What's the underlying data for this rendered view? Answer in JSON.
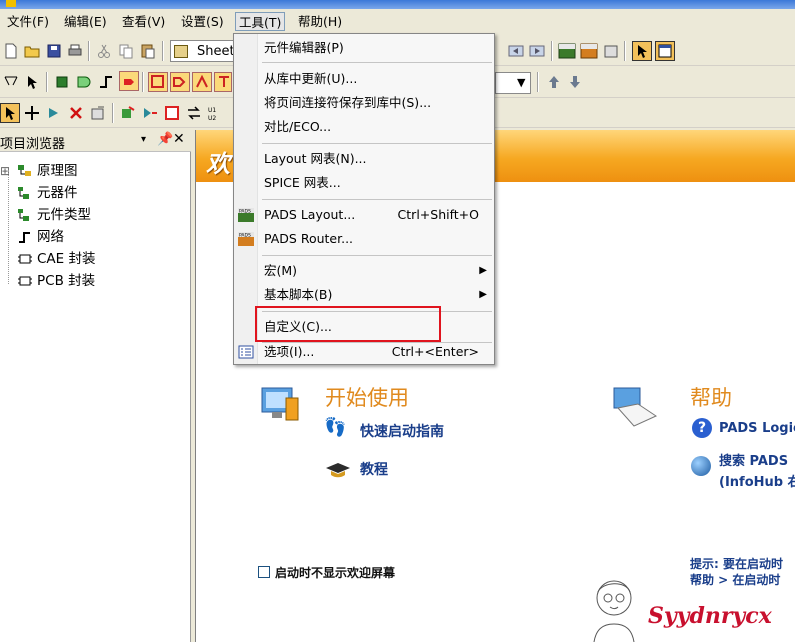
{
  "menubar": {
    "items": [
      {
        "label": "文件(F)"
      },
      {
        "label": "编辑(E)"
      },
      {
        "label": "查看(V)"
      },
      {
        "label": "设置(S)"
      },
      {
        "label": "工具(T)",
        "active": true
      },
      {
        "label": "帮助(H)"
      }
    ]
  },
  "toolbar": {
    "sheet_label": "Sheet"
  },
  "browser": {
    "title": "项目浏览器",
    "pin": "▾",
    "close": "✕",
    "items": [
      {
        "label": "原理图",
        "expander": "⊞"
      },
      {
        "label": "元器件"
      },
      {
        "label": "元件类型"
      },
      {
        "label": "网络"
      },
      {
        "label": "CAE 封装"
      },
      {
        "label": "PCB 封装"
      }
    ]
  },
  "tools_menu": {
    "items": [
      {
        "label": "元件编辑器(P)"
      },
      {
        "label": "从库中更新(U)..."
      },
      {
        "label": "将页间连接符保存到库中(S)..."
      },
      {
        "label": "对比/ECO..."
      },
      {
        "label": "Layout 网表(N)..."
      },
      {
        "label": "SPICE 网表..."
      },
      {
        "label": "PADS Layout...",
        "shortcut": "Ctrl+Shift+O",
        "icon": "pads-layout-icon"
      },
      {
        "label": "PADS Router...",
        "icon": "pads-router-icon"
      },
      {
        "label": "宏(M)",
        "submenu": "▶"
      },
      {
        "label": "基本脚本(B)",
        "submenu": "▶"
      },
      {
        "label": "自定义(C)..."
      },
      {
        "label": "选项(I)...",
        "shortcut": "Ctrl+<Enter>",
        "icon": "options-list-icon"
      }
    ]
  },
  "welcome": {
    "banner": "欢",
    "start": {
      "title": "开始使用",
      "quickstart": "快速启动指南",
      "tutorial": "教程"
    },
    "help": {
      "title": "帮助",
      "pads_logic": "PADS Logic",
      "search_line1": "搜索  PADS",
      "search_line2": "(InfoHub 右"
    },
    "tip_line1": "提示: 要在启动时",
    "tip_line2": "帮助  > 在启动时",
    "checkbox_label": "启动时不显示欢迎屏幕"
  },
  "watermark": "Syydnrycx",
  "colors": {
    "highlight_box": "#e0141e",
    "banner_orange": "#f6a821",
    "link_blue": "#1a3e8a",
    "section_orange": "#e08a1e"
  }
}
